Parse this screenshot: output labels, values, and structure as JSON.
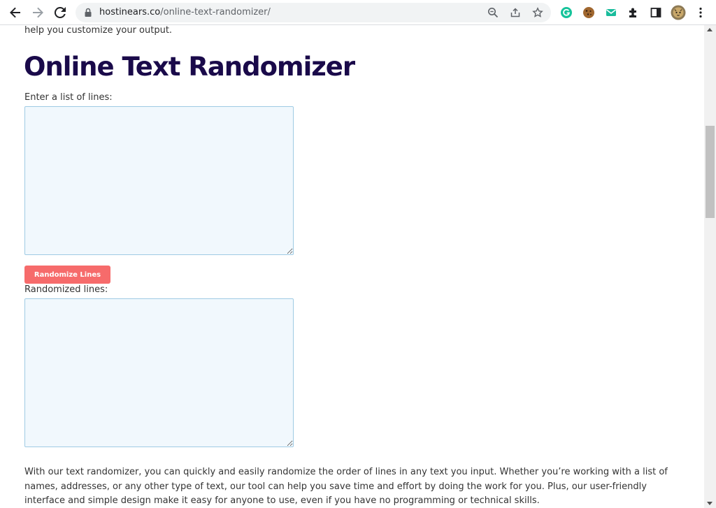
{
  "browser": {
    "url_domain": "hostinears.co",
    "url_path": "/online-text-randomizer/"
  },
  "icons": {
    "back": "back-arrow-icon",
    "forward": "forward-arrow-icon",
    "reload": "reload-icon",
    "lock": "lock-icon",
    "zoom": "zoom-icon",
    "share": "share-icon",
    "bookmark": "star-icon",
    "grammarly": "grammarly-icon",
    "cookie": "cookie-icon",
    "mail": "mail-icon",
    "extensions": "puzzle-icon",
    "side_panel": "side-panel-icon",
    "profile": "avatar",
    "menu": "kebab-menu-icon"
  },
  "colors": {
    "title": "#1a0a4a",
    "button": "#f66b6b",
    "textarea_bg": "#f1f8fd",
    "textarea_border": "#9fcbe4"
  },
  "page": {
    "intro_tail": "help you customize your output.",
    "title": "Online Text Randomizer",
    "input_label": "Enter a list of lines:",
    "input_value": "",
    "button_label": "Randomize Lines",
    "output_label": "Randomized lines:",
    "output_value": "",
    "paragraph": "With our text randomizer, you can quickly and easily randomize the order of lines in any text you input. Whether you’re working with a list of names, addresses, or any other type of text, our tool can help you save time and effort by doing the work for you. Plus, our user-friendly interface and simple design make it easy for anyone to use, even if you have no programming or technical skills."
  }
}
